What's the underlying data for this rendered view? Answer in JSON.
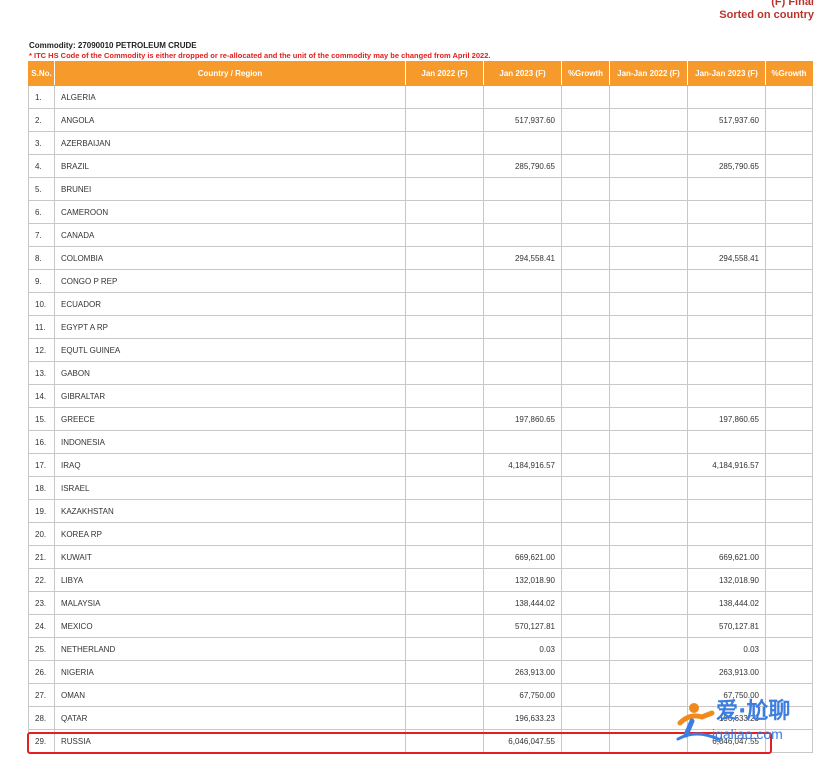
{
  "header": {
    "line1": "(F) Final",
    "line2": "Sorted on country"
  },
  "commodity": "Commodity:  27090010 PETROLEUM CRUDE",
  "note": "* ITC HS Code of the Commodity is either dropped or re-allocated and the unit of the commodity may be changed from April 2022.",
  "columns": [
    "S.No.",
    "Country / Region",
    "Jan  2022 (F)",
    "Jan  2023 (F)",
    "%Growth",
    "Jan-Jan  2022 (F)",
    "Jan-Jan  2023 (F)",
    "%Growth"
  ],
  "rows": [
    [
      "1.",
      "ALGERIA",
      "",
      "",
      "",
      "",
      "",
      ""
    ],
    [
      "2.",
      "ANGOLA",
      "",
      "517,937.60",
      "",
      "",
      "517,937.60",
      ""
    ],
    [
      "3.",
      "AZERBAIJAN",
      "",
      "",
      "",
      "",
      "",
      ""
    ],
    [
      "4.",
      "BRAZIL",
      "",
      "285,790.65",
      "",
      "",
      "285,790.65",
      ""
    ],
    [
      "5.",
      "BRUNEI",
      "",
      "",
      "",
      "",
      "",
      ""
    ],
    [
      "6.",
      "CAMEROON",
      "",
      "",
      "",
      "",
      "",
      ""
    ],
    [
      "7.",
      "CANADA",
      "",
      "",
      "",
      "",
      "",
      ""
    ],
    [
      "8.",
      "COLOMBIA",
      "",
      "294,558.41",
      "",
      "",
      "294,558.41",
      ""
    ],
    [
      "9.",
      "CONGO P REP",
      "",
      "",
      "",
      "",
      "",
      ""
    ],
    [
      "10.",
      "ECUADOR",
      "",
      "",
      "",
      "",
      "",
      ""
    ],
    [
      "11.",
      "EGYPT A RP",
      "",
      "",
      "",
      "",
      "",
      ""
    ],
    [
      "12.",
      "EQUTL GUINEA",
      "",
      "",
      "",
      "",
      "",
      ""
    ],
    [
      "13.",
      "GABON",
      "",
      "",
      "",
      "",
      "",
      ""
    ],
    [
      "14.",
      "GIBRALTAR",
      "",
      "",
      "",
      "",
      "",
      ""
    ],
    [
      "15.",
      "GREECE",
      "",
      "197,860.65",
      "",
      "",
      "197,860.65",
      ""
    ],
    [
      "16.",
      "INDONESIA",
      "",
      "",
      "",
      "",
      "",
      ""
    ],
    [
      "17.",
      "IRAQ",
      "",
      "4,184,916.57",
      "",
      "",
      "4,184,916.57",
      ""
    ],
    [
      "18.",
      "ISRAEL",
      "",
      "",
      "",
      "",
      "",
      ""
    ],
    [
      "19.",
      "KAZAKHSTAN",
      "",
      "",
      "",
      "",
      "",
      ""
    ],
    [
      "20.",
      "KOREA RP",
      "",
      "",
      "",
      "",
      "",
      ""
    ],
    [
      "21.",
      "KUWAIT",
      "",
      "669,621.00",
      "",
      "",
      "669,621.00",
      ""
    ],
    [
      "22.",
      "LIBYA",
      "",
      "132,018.90",
      "",
      "",
      "132,018.90",
      ""
    ],
    [
      "23.",
      "MALAYSIA",
      "",
      "138,444.02",
      "",
      "",
      "138,444.02",
      ""
    ],
    [
      "24.",
      "MEXICO",
      "",
      "570,127.81",
      "",
      "",
      "570,127.81",
      ""
    ],
    [
      "25.",
      "NETHERLAND",
      "",
      "0.03",
      "",
      "",
      "0.03",
      ""
    ],
    [
      "26.",
      "NIGERIA",
      "",
      "263,913.00",
      "",
      "",
      "263,913.00",
      ""
    ],
    [
      "27.",
      "OMAN",
      "",
      "67,750.00",
      "",
      "",
      "67,750.00",
      ""
    ],
    [
      "28.",
      "QATAR",
      "",
      "196,633.23",
      "",
      "",
      "196,633.23",
      ""
    ],
    [
      "29.",
      "RUSSIA",
      "",
      "6,046,047.55",
      "",
      "",
      "6,046,047.55",
      ""
    ]
  ],
  "watermark": {
    "line1": "爱·尬聊",
    "line2": "igaliao.com"
  },
  "colors": {
    "header_bg": "#f79a2c",
    "header_text": "#ffffff",
    "note": "#e0201e",
    "title": "#b8342c",
    "highlight": "#e51e1e"
  }
}
